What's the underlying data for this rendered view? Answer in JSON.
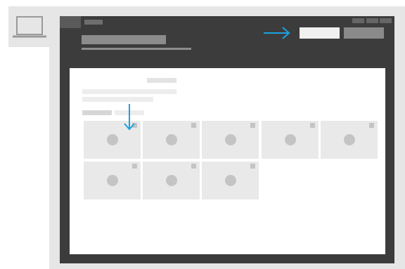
{
  "sidebar": {
    "device_icon": "laptop-icon"
  },
  "header": {
    "arrow_icon": "arrow-right-icon",
    "primary_button_label": "",
    "secondary_button_label": ""
  },
  "panel": {
    "arrow_icon": "arrow-down-icon",
    "tile_icon": "image-placeholder-icon",
    "tile_count": 8
  },
  "colors": {
    "window": "#3c3c3c",
    "frame": "#e6e6e6",
    "accent": "#1aa3e0",
    "tile": "#e9e9e9"
  }
}
